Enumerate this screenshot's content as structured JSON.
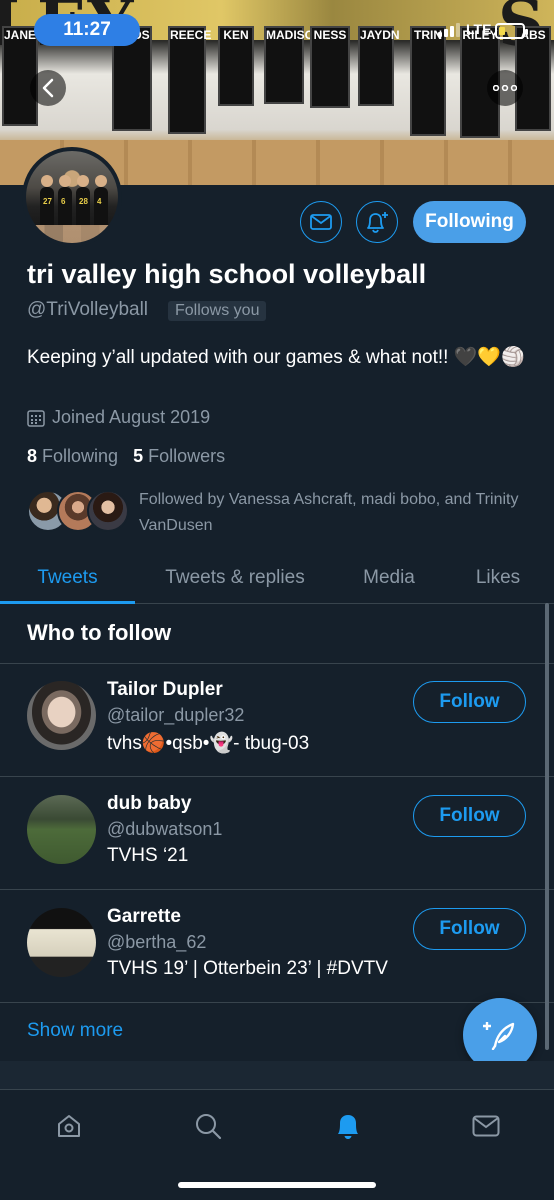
{
  "status_bar": {
    "time": "11:27",
    "network": "LTE"
  },
  "banner": {
    "scoreboard_left": "LEY",
    "scoreboard_right": "S",
    "jersey_words": [
      "JANE",
      "MADS",
      "REECE",
      "KEN",
      "MADISON",
      "NESS",
      "JAYDN",
      "TRIN",
      "RILEY",
      "ABS"
    ]
  },
  "profile": {
    "name": "tri valley high school volleyball",
    "handle": "@TriVolleyball",
    "follows_you_label": "Follows you",
    "bio": "Keeping y’all updated with our games & what not!! 🖤💛🏐",
    "joined": "Joined August 2019",
    "following_count": "8",
    "following_label": "Following",
    "followers_count": "5",
    "followers_label": "Followers",
    "followed_by": "Followed by Vanessa Ashcraft, madi bobo, and Trinity VanDusen",
    "following_button_label": "Following"
  },
  "tabs": [
    {
      "label": "Tweets",
      "active": true
    },
    {
      "label": "Tweets & replies",
      "active": false
    },
    {
      "label": "Media",
      "active": false
    },
    {
      "label": "Likes",
      "active": false
    }
  ],
  "who_to_follow": {
    "title": "Who to follow",
    "follow_label": "Follow",
    "show_more": "Show more",
    "users": [
      {
        "name": "Tailor Dupler",
        "handle": "@tailor_dupler32",
        "bio": "tvhs🏀•qsb•👻- tbug-03"
      },
      {
        "name": "dub baby",
        "handle": "@dubwatson1",
        "bio": "TVHS ‘21"
      },
      {
        "name": "Garrette",
        "handle": "@bertha_62",
        "bio": "TVHS 19’ | Otterbein 23’ | #DVTV"
      }
    ]
  },
  "bottom_nav": [
    "home-icon",
    "search-icon",
    "notifications-icon",
    "messages-icon"
  ],
  "colors": {
    "background": "#15202b",
    "accent": "#1d9bf0",
    "button_fill": "#4a9fe8",
    "muted": "#8b98a5",
    "divider": "#38444d"
  }
}
